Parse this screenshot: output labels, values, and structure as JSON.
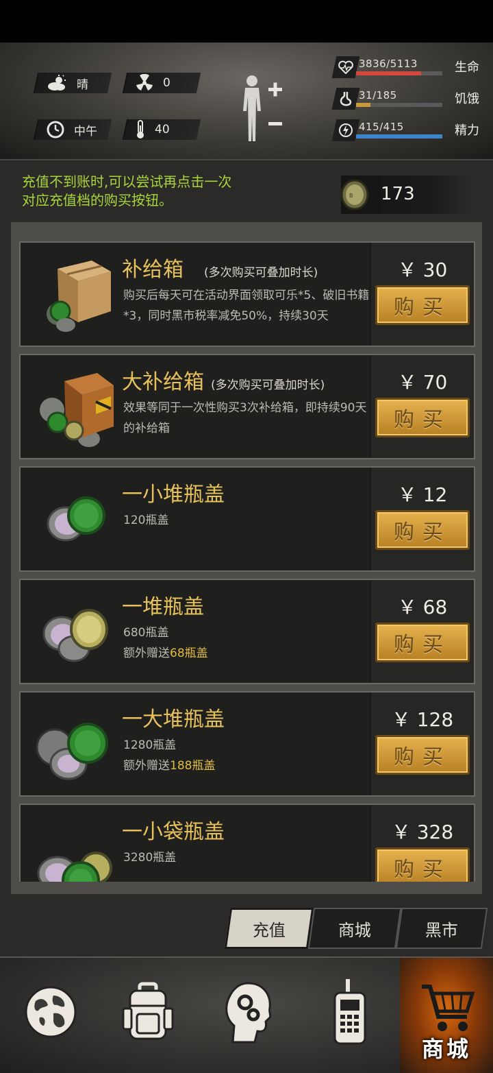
{
  "header": {
    "weather": "晴",
    "radiation": "0",
    "time_of_day": "中午",
    "temperature": "40",
    "stats": [
      {
        "label": "生命",
        "value": "3836/5113",
        "current": 3836,
        "max": 5113,
        "color": "#d24a3e"
      },
      {
        "label": "饥饿",
        "value": "31/185",
        "current": 31,
        "max": 185,
        "color": "#c69a3a"
      },
      {
        "label": "精力",
        "value": "415/415",
        "current": 415,
        "max": 415,
        "color": "#3d85c6"
      }
    ]
  },
  "shop": {
    "tip_line1": "充值不到账时,可以尝试再点击一次",
    "tip_line2": "对应充值档的购买按钮。",
    "caps_balance": "173",
    "buy_label": "购买",
    "items": [
      {
        "title": "补给箱",
        "note": "(多次购买可叠加时长)",
        "desc": "购买后每天可在活动界面领取可乐*5、破旧书籍*3，同时黑市税率减免50%，持续30天",
        "bonus_prefix": "",
        "bonus_amount": "",
        "price": "￥ 30",
        "icon": "supply-box-icon"
      },
      {
        "title": "大补给箱",
        "note": "(多次购买可叠加时长)",
        "desc": "效果等同于一次性购买3次补给箱，即持续90天的补给箱",
        "bonus_prefix": "",
        "bonus_amount": "",
        "price": "￥ 70",
        "icon": "large-supply-box-icon"
      },
      {
        "title": "一小堆瓶盖",
        "note": "",
        "desc": "120瓶盖",
        "bonus_prefix": "",
        "bonus_amount": "",
        "price": "￥ 12",
        "icon": "small-pile-caps-icon"
      },
      {
        "title": "一堆瓶盖",
        "note": "",
        "desc": "680瓶盖",
        "bonus_prefix": "额外赠送",
        "bonus_amount": "68瓶盖",
        "price": "￥ 68",
        "icon": "pile-caps-icon"
      },
      {
        "title": "一大堆瓶盖",
        "note": "",
        "desc": "1280瓶盖",
        "bonus_prefix": "额外赠送",
        "bonus_amount": "188瓶盖",
        "price": "￥ 128",
        "icon": "big-pile-caps-icon"
      },
      {
        "title": "一小袋瓶盖",
        "note": "",
        "desc": "3280瓶盖",
        "bonus_prefix": "",
        "bonus_amount": "",
        "price": "￥ 328",
        "icon": "small-bag-caps-icon"
      }
    ],
    "tabs": [
      "充值",
      "商城",
      "黑市"
    ],
    "active_tab": 0
  },
  "nav": {
    "items": [
      "world-map-icon",
      "backpack-icon",
      "skills-head-icon",
      "radio-icon",
      "shop-cart-icon"
    ],
    "shop_label": "商城"
  }
}
